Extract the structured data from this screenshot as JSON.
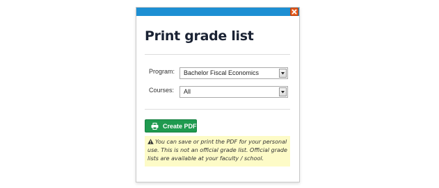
{
  "dialog": {
    "title": "Print grade list",
    "close_icon": "close-icon",
    "accent_color": "#1d8fd3",
    "close_color": "#e45b1f"
  },
  "form": {
    "program_label": "Program:",
    "program_value": "Bachelor Fiscal Economics",
    "courses_label": "Courses:",
    "courses_value": "All"
  },
  "actions": {
    "create_pdf_label": "Create PDF",
    "create_pdf_icon": "printer-icon",
    "button_color": "#1f9a4f"
  },
  "notice": {
    "icon": "warning-icon",
    "text": "You can save or print the PDF for your personal use. This is not an official grade list. Official grade lists are available at your faculty / school.",
    "background": "#fdfbc7"
  }
}
